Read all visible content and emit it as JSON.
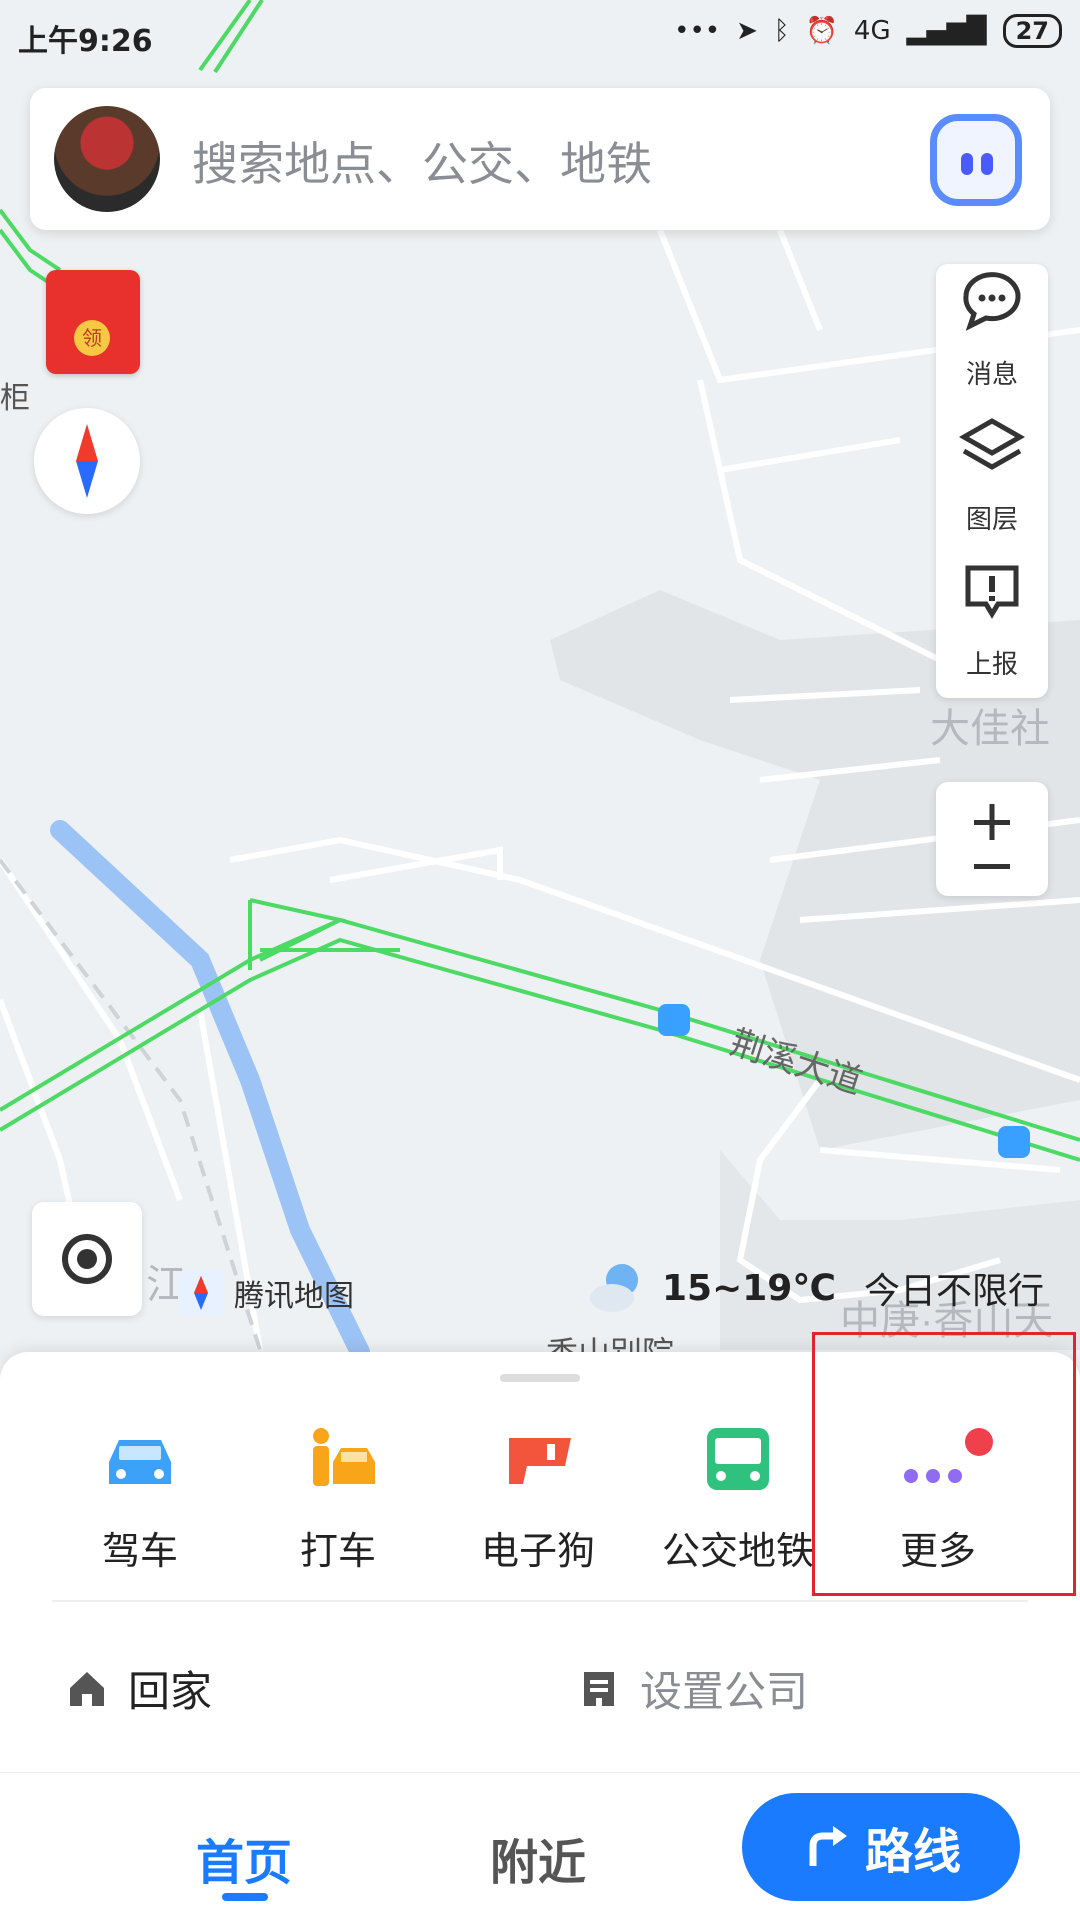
{
  "status_bar": {
    "time": "上午9:26",
    "battery": "27",
    "network": "4G"
  },
  "search": {
    "placeholder": "搜索地点、公交、地铁"
  },
  "map": {
    "road_label": "荆溪大道",
    "area_labels": [
      "大佳社",
      "柜",
      "香山别院",
      "中庚·香山天",
      "江"
    ],
    "brand": "腾讯地图",
    "temperature": "15~19℃",
    "traffic_limit": "今日不限行"
  },
  "right_panel": {
    "messages": "消息",
    "layers": "图层",
    "report": "上报"
  },
  "services": [
    {
      "label": "驾车",
      "icon": "car-icon"
    },
    {
      "label": "打车",
      "icon": "taxi-icon"
    },
    {
      "label": "电子狗",
      "icon": "speed-camera-icon"
    },
    {
      "label": "公交地铁",
      "icon": "bus-icon"
    },
    {
      "label": "更多",
      "icon": "more-icon"
    }
  ],
  "shortcuts": {
    "home": "回家",
    "company": "设置公司"
  },
  "tabs": {
    "home": "首页",
    "nearby": "附近",
    "route": "路线"
  },
  "redpack": {
    "coin": "领"
  },
  "colors": {
    "accent": "#1a7bff",
    "traffic_green": "#4cd964",
    "river": "#9cc3f5"
  }
}
